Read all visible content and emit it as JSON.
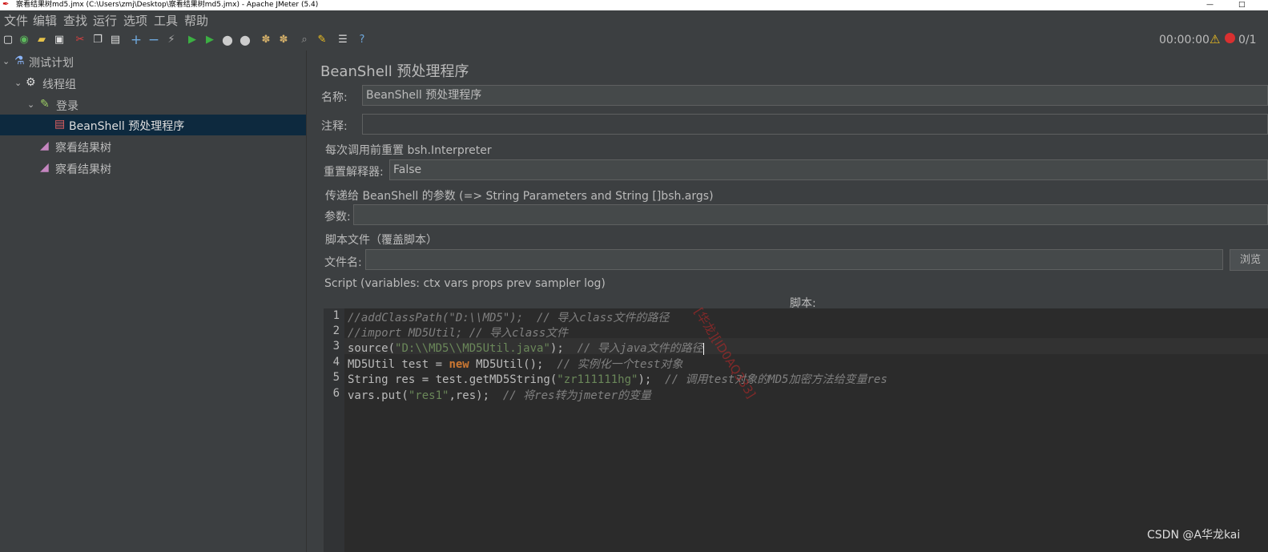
{
  "window": {
    "title": "察看结果树md5.jmx (C:\\Users\\zmj\\Desktop\\察看结果树md5.jmx) - Apache JMeter (5.4)",
    "minimize": "—",
    "maximize": "□"
  },
  "menu": [
    "文件",
    "编辑",
    "查找",
    "运行",
    "选项",
    "工具",
    "帮助"
  ],
  "toolbar": {
    "timer": "00:00:00",
    "count": "0/1"
  },
  "tree": {
    "test_plan": "测试计划",
    "thread_group": "线程组",
    "login": "登录",
    "beanshell": "BeanShell 预处理程序",
    "listener1": "察看结果树",
    "listener2": "察看结果树"
  },
  "panel": {
    "title": "BeanShell 预处理程序",
    "name_label": "名称:",
    "name_value": "BeanShell 预处理程序",
    "comment_label": "注释:",
    "comment_value": "",
    "reset_section": "每次调用前重置 bsh.Interpreter",
    "reset_label": "重置解释器:",
    "reset_value": "False",
    "params_section": "传递给 BeanShell 的参数 (=> String Parameters and String []bsh.args)",
    "params_label": "参数:",
    "params_value": "",
    "script_file_section": "脚本文件（覆盖脚本）",
    "filename_label": "文件名:",
    "filename_value": "",
    "browse_label": "浏览",
    "script_section": "Script (variables: ctx vars props prev sampler log)",
    "script_label": "脚本:"
  },
  "script": {
    "line_numbers": [
      "1",
      "2",
      "3",
      "4",
      "5",
      "6"
    ],
    "line1": {
      "comment": "//addClassPath(\"D:\\\\MD5\");  // 导入class文件的路径"
    },
    "line2": {
      "comment": "//import MD5Util; // 导入class文件"
    },
    "line3": {
      "a": "source(",
      "str": "\"D:\\\\MD5\\\\MD5Util.java\"",
      "b": ");  ",
      "comment": "// 导入java文件的路径"
    },
    "line4": {
      "a": "MD5Util test = ",
      "kw": "new",
      "b": " MD5Util();  ",
      "comment": "// 实例化一个test对象"
    },
    "line5": {
      "a": "String res = test.getMD5String(",
      "str": "\"zr111111hg\"",
      "b": ");  ",
      "comment": "// 调用test对象的MD5加密方法给变量res"
    },
    "line6": {
      "a": "vars.put(",
      "str": "\"res1\"",
      "b": ",res);  ",
      "comment": "// 将res转为jmeter的变量"
    }
  },
  "watermark": "[华龙][ID0AQ333]",
  "footer": "CSDN @A华龙kai",
  "colors": {
    "background": "#3c3f41",
    "editor": "#2b2b2b",
    "selection": "#0d293e",
    "string": "#6a8759",
    "keyword": "#cc7832",
    "comment": "#808080"
  }
}
